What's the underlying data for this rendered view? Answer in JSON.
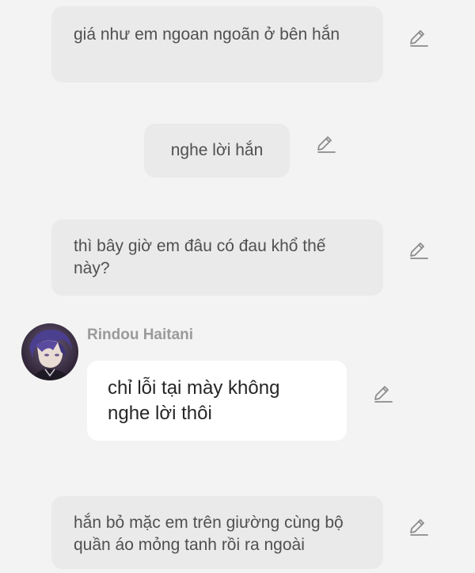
{
  "messages": [
    {
      "text": "giá như em ngoan ngoãn ở bên hắn"
    },
    {
      "text": "nghe lời hắn"
    },
    {
      "text": "thì bây giờ em đâu có đau khổ thế này?"
    },
    {
      "sender": "Rindou Haitani",
      "text": "chỉ lỗi tại mày không nghe lời thôi"
    },
    {
      "text": "hắn bỏ mặc em trên giường cùng bộ quần áo mỏng tanh rồi ra ngoài"
    }
  ],
  "icons": {
    "edit": "pencil-edit-icon",
    "avatar": "character-avatar"
  },
  "colors": {
    "background": "#f3f3f3",
    "narration_bubble": "#eaeaea",
    "character_bubble": "#ffffff",
    "sender_name": "#9a9a9a",
    "icon": "#8c8c8c"
  }
}
